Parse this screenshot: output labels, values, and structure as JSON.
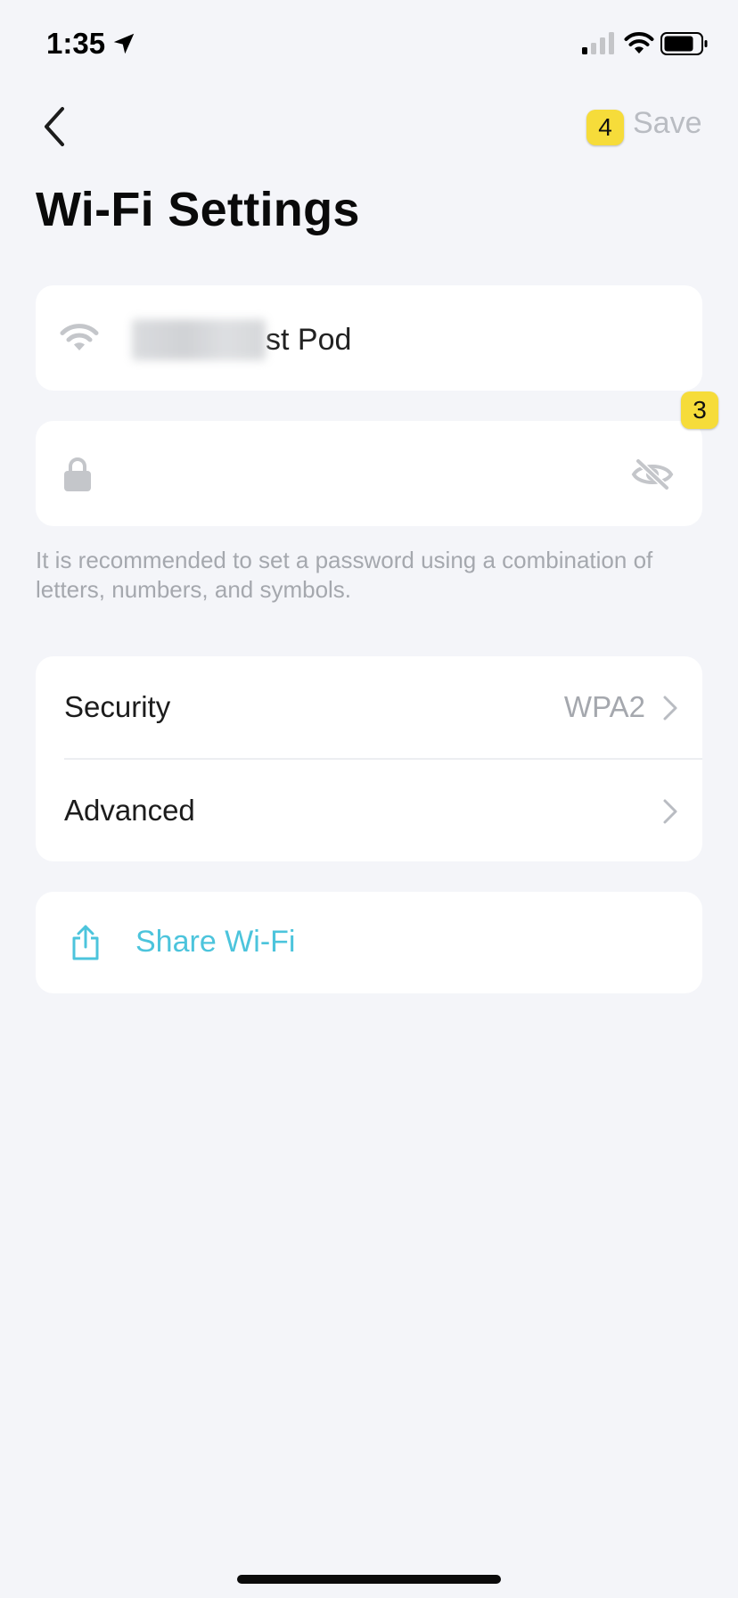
{
  "status_bar": {
    "time": "1:35"
  },
  "header": {
    "save_label": "Save",
    "save_badge": "4",
    "title": "Wi-Fi Settings"
  },
  "network": {
    "ssid_visible_suffix": "st Pod"
  },
  "password": {
    "badge": "3",
    "hint": "It is recommended to set a password using a combination of letters, numbers, and symbols."
  },
  "settings": {
    "security_label": "Security",
    "security_value": "WPA2",
    "advanced_label": "Advanced"
  },
  "share": {
    "label": "Share Wi-Fi"
  },
  "colors": {
    "background": "#f4f5f9",
    "accent": "#4cc4dc",
    "muted": "#a5a8ae",
    "badge": "#f6dc3a"
  },
  "icons": [
    "location-arrow-icon",
    "cellular-signal-icon",
    "wifi-status-icon",
    "battery-icon",
    "back-chevron-icon",
    "wifi-icon",
    "lock-icon",
    "eye-slash-icon",
    "chevron-right-icon",
    "share-icon"
  ]
}
